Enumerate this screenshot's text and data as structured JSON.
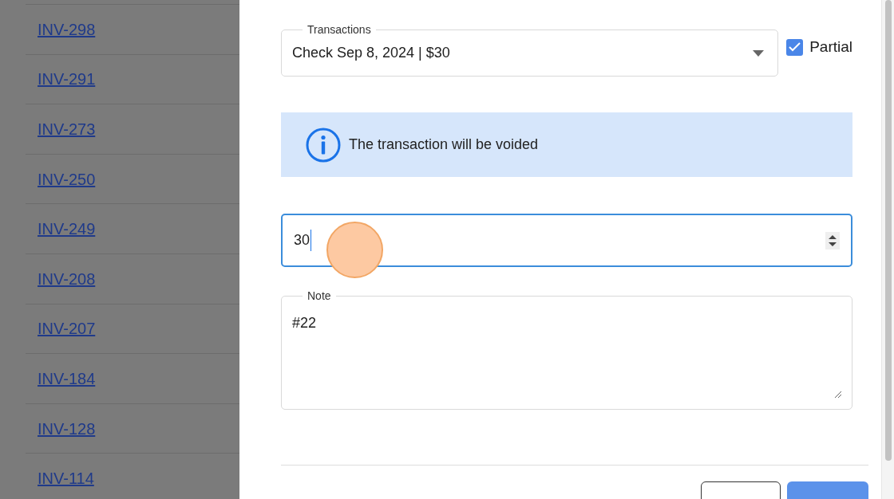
{
  "invoices": [
    {
      "label": "INV-298"
    },
    {
      "label": "INV-291"
    },
    {
      "label": "INV-273"
    },
    {
      "label": "INV-250"
    },
    {
      "label": "INV-249"
    },
    {
      "label": "INV-208"
    },
    {
      "label": "INV-207"
    },
    {
      "label": "INV-184"
    },
    {
      "label": "INV-128"
    },
    {
      "label": "INV-114"
    }
  ],
  "dialog": {
    "transactions": {
      "label": "Transactions",
      "value": "Check Sep 8, 2024 | $30"
    },
    "partial": {
      "label": "Partial",
      "checked": true
    },
    "alert": {
      "text": "The transaction will be voided"
    },
    "amount": {
      "value": "30",
      "focused": true
    },
    "note": {
      "label": "Note",
      "value": "#22"
    },
    "buttons": [
      {
        "kind": "outline"
      },
      {
        "kind": "primary"
      }
    ]
  }
}
